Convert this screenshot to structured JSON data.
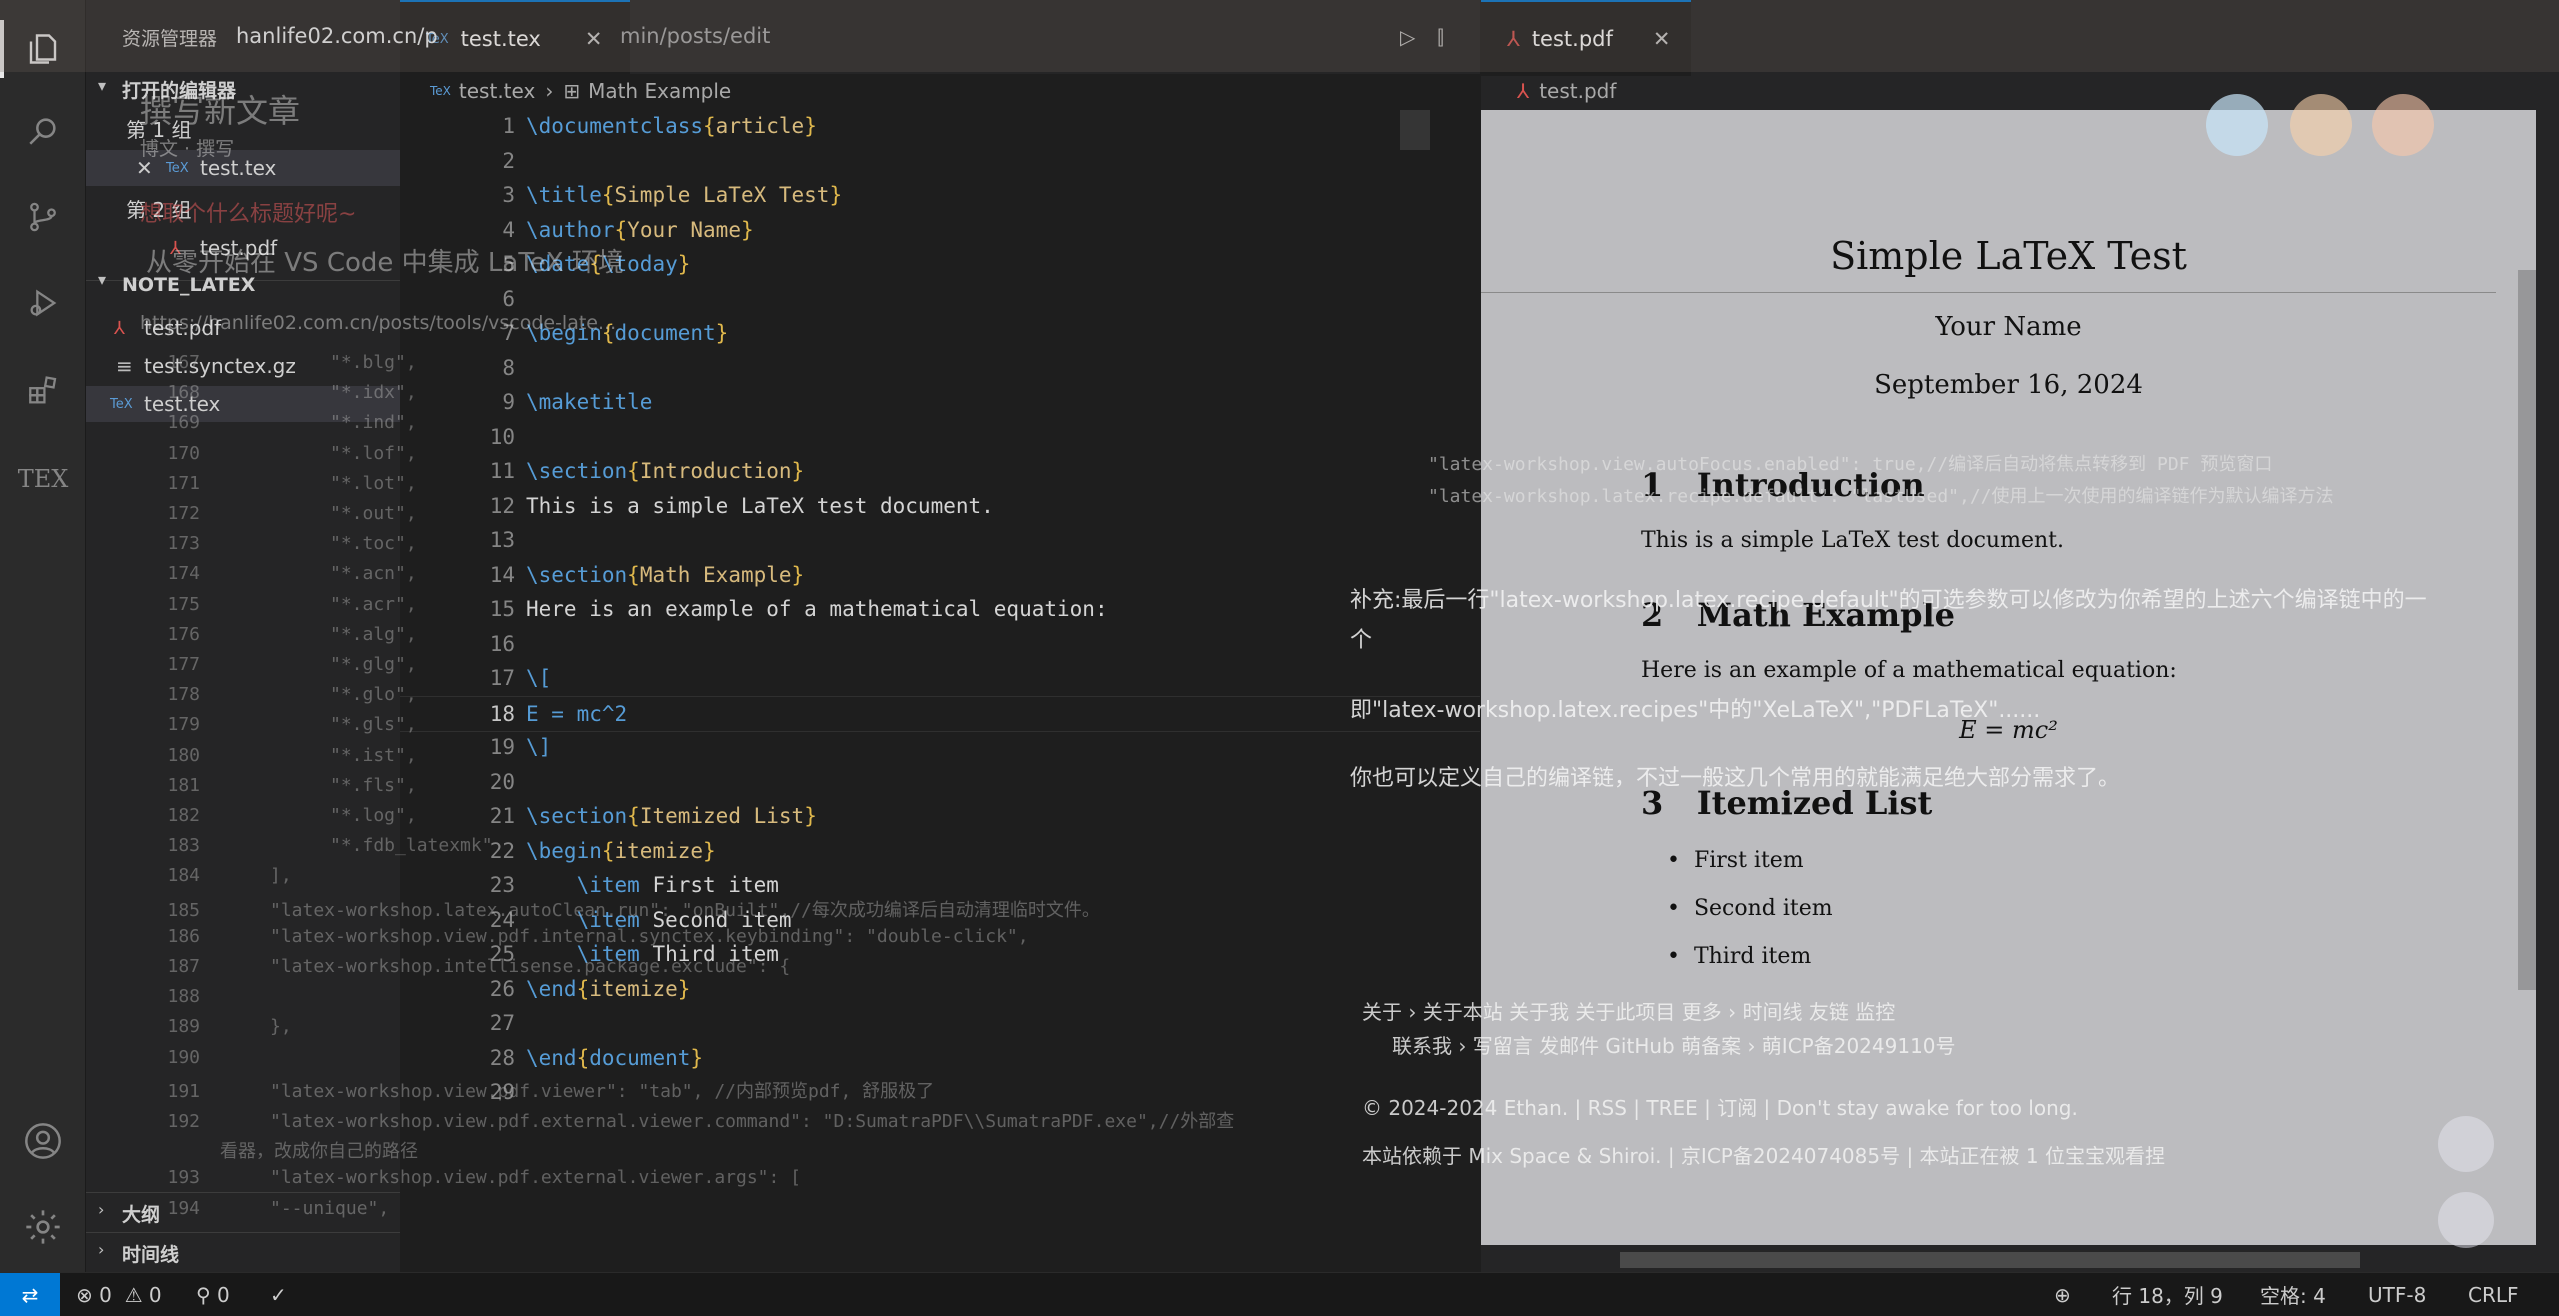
{
  "browser": {
    "url": "hanlife02.com.cn/p",
    "url_tail": "min/posts/edit"
  },
  "activity": {
    "icons": [
      "files-icon",
      "search-icon",
      "source-control-icon",
      "run-debug-icon",
      "extensions-icon",
      "tex-icon",
      "account-icon",
      "gear-icon"
    ],
    "tex_label": "TEX"
  },
  "sidebar": {
    "title": "资源管理器",
    "open_editors": {
      "title": "打开的编辑器",
      "group1": "第 1 组",
      "group1_file": "test.tex",
      "group2": "第 2 组",
      "group2_file": "test.pdf"
    },
    "folder": {
      "title": "NOTE_LATEX",
      "files": [
        "test.pdf",
        "test.synctex.gz",
        "test.tex"
      ]
    },
    "outline": "大纲",
    "timeline": "时间线"
  },
  "editor": {
    "tab_label": "test.tex",
    "breadcrumb_file": "test.tex",
    "breadcrumb_symbol": "Math Example",
    "current_line": "18",
    "lines": [
      {
        "n": "1",
        "t": [
          [
            "kw",
            "\\documentclass"
          ],
          [
            "br",
            "{"
          ],
          [
            "gr",
            "article"
          ],
          [
            "br",
            "}"
          ]
        ]
      },
      {
        "n": "2",
        "t": []
      },
      {
        "n": "3",
        "t": [
          [
            "kw",
            "\\title"
          ],
          [
            "br",
            "{"
          ],
          [
            "gr",
            "Simple LaTeX Test"
          ],
          [
            "br",
            "}"
          ]
        ]
      },
      {
        "n": "4",
        "t": [
          [
            "kw",
            "\\author"
          ],
          [
            "br",
            "{"
          ],
          [
            "gr",
            "Your Name"
          ],
          [
            "br",
            "}"
          ]
        ]
      },
      {
        "n": "5",
        "t": [
          [
            "kw",
            "\\date"
          ],
          [
            "br",
            "{"
          ],
          [
            "kw",
            "\\today"
          ],
          [
            "br",
            "}"
          ]
        ]
      },
      {
        "n": "6",
        "t": []
      },
      {
        "n": "7",
        "t": [
          [
            "kw",
            "\\begin"
          ],
          [
            "br",
            "{"
          ],
          [
            "kw",
            "document"
          ],
          [
            "br",
            "}"
          ]
        ]
      },
      {
        "n": "8",
        "t": []
      },
      {
        "n": "9",
        "t": [
          [
            "kw",
            "\\maketitle"
          ]
        ]
      },
      {
        "n": "10",
        "t": []
      },
      {
        "n": "11",
        "t": [
          [
            "kw",
            "\\section"
          ],
          [
            "br",
            "{"
          ],
          [
            "gr",
            "Introduction"
          ],
          [
            "br",
            "}"
          ]
        ]
      },
      {
        "n": "12",
        "t": [
          [
            "",
            "This is a simple LaTeX test document."
          ]
        ]
      },
      {
        "n": "13",
        "t": []
      },
      {
        "n": "14",
        "t": [
          [
            "kw",
            "\\section"
          ],
          [
            "br",
            "{"
          ],
          [
            "gr",
            "Math Example"
          ],
          [
            "br",
            "}"
          ]
        ]
      },
      {
        "n": "15",
        "t": [
          [
            "",
            "Here is an example of a mathematical equation:"
          ]
        ]
      },
      {
        "n": "16",
        "t": []
      },
      {
        "n": "17",
        "t": [
          [
            "kw",
            "\\["
          ]
        ]
      },
      {
        "n": "18",
        "t": [
          [
            "kw",
            "E = mc^2"
          ]
        ]
      },
      {
        "n": "19",
        "t": [
          [
            "kw",
            "\\]"
          ]
        ]
      },
      {
        "n": "20",
        "t": []
      },
      {
        "n": "21",
        "t": [
          [
            "kw",
            "\\section"
          ],
          [
            "br",
            "{"
          ],
          [
            "gr",
            "Itemized List"
          ],
          [
            "br",
            "}"
          ]
        ]
      },
      {
        "n": "22",
        "t": [
          [
            "kw",
            "\\begin"
          ],
          [
            "br",
            "{"
          ],
          [
            "gr",
            "itemize"
          ],
          [
            "br",
            "}"
          ]
        ]
      },
      {
        "n": "23",
        "t": [
          [
            "",
            "    "
          ],
          [
            "kw",
            "\\item"
          ],
          [
            "",
            " First item"
          ]
        ]
      },
      {
        "n": "24",
        "t": [
          [
            "",
            "    "
          ],
          [
            "kw",
            "\\item"
          ],
          [
            "",
            " Second item"
          ]
        ]
      },
      {
        "n": "25",
        "t": [
          [
            "",
            "    "
          ],
          [
            "kw",
            "\\item"
          ],
          [
            "",
            " Third item"
          ]
        ]
      },
      {
        "n": "26",
        "t": [
          [
            "kw",
            "\\end"
          ],
          [
            "br",
            "{"
          ],
          [
            "gr",
            "itemize"
          ],
          [
            "br",
            "}"
          ]
        ]
      },
      {
        "n": "27",
        "t": []
      },
      {
        "n": "28",
        "t": [
          [
            "kw",
            "\\end"
          ],
          [
            "br",
            "{"
          ],
          [
            "kw",
            "document"
          ],
          [
            "br",
            "}"
          ]
        ]
      },
      {
        "n": "29",
        "t": []
      }
    ]
  },
  "pdf": {
    "tab_label": "test.pdf",
    "breadcrumb": "test.pdf",
    "title": "Simple LaTeX Test",
    "author": "Your Name",
    "date": "September 16, 2024",
    "sec1_num": "1",
    "sec1": "Introduction",
    "sec1_body": "This is a simple LaTeX test document.",
    "sec2_num": "2",
    "sec2": "Math Example",
    "sec2_body": "Here is an example of a mathematical equation:",
    "equation": "E = mc²",
    "sec3_num": "3",
    "sec3": "Itemized List",
    "items": [
      "First item",
      "Second item",
      "Third item"
    ]
  },
  "ghost": {
    "page_title": "撰写新文章",
    "page_sub": "博文 · 撰写",
    "placeholder": "想取个什么标题好呢~",
    "post_title": "从零开始在 VS Code 中集成 LaTeX 环境",
    "post_url": "https://hanlife02.com.cn/posts/tools/vscode-late...",
    "code_lines": [
      {
        "n": "167",
        "t": "\"*.blg\","
      },
      {
        "n": "168",
        "t": "\"*.idx\","
      },
      {
        "n": "169",
        "t": "\"*.ind\","
      },
      {
        "n": "170",
        "t": "\"*.lof\","
      },
      {
        "n": "171",
        "t": "\"*.lot\","
      },
      {
        "n": "172",
        "t": "\"*.out\","
      },
      {
        "n": "173",
        "t": "\"*.toc\","
      },
      {
        "n": "174",
        "t": "\"*.acn\","
      },
      {
        "n": "175",
        "t": "\"*.acr\","
      },
      {
        "n": "176",
        "t": "\"*.alg\","
      },
      {
        "n": "177",
        "t": "\"*.glg\","
      },
      {
        "n": "178",
        "t": "\"*.glo\","
      },
      {
        "n": "179",
        "t": "\"*.gls\","
      },
      {
        "n": "180",
        "t": "\"*.ist\","
      },
      {
        "n": "181",
        "t": "\"*.fls\","
      },
      {
        "n": "182",
        "t": "\"*.log\","
      },
      {
        "n": "183",
        "t": "\"*.fdb_latexmk\""
      },
      {
        "n": "184",
        "t": "],"
      },
      {
        "n": "185",
        "t": "\"latex-workshop.latex.autoClean.run\": \"onBuilt\",//每次成功编译后自动清理临时文件。"
      },
      {
        "n": "186",
        "t": "\"latex-workshop.view.pdf.internal.synctex.keybinding\": \"double-click\","
      },
      {
        "n": "187",
        "t": "\"latex-workshop.intellisense.package.exclude\": {"
      },
      {
        "n": "188",
        "t": ""
      },
      {
        "n": "189",
        "t": "},"
      },
      {
        "n": "190",
        "t": ""
      },
      {
        "n": "191",
        "t": "\"latex-workshop.view.pdf.viewer\": \"tab\",  //内部预览pdf, 舒服极了"
      },
      {
        "n": "192",
        "t": "\"latex-workshop.view.pdf.external.viewer.command\": \"D:SumatraPDF\\\\SumatraPDF.exe\",//外部查"
      },
      {
        "n": "",
        "t": "看器，改成你自己的路径"
      },
      {
        "n": "193",
        "t": "\"latex-workshop.view.pdf.external.viewer.args\": ["
      },
      {
        "n": "194",
        "t": "\"--unique\","
      }
    ],
    "pdf_code1": "\"latex-workshop.view.autoFocus.enabled\": true,//编译后自动将焦点转移到 PDF 预览窗口",
    "pdf_code2": "\"latex-workshop.latex.recipe.default\": \"lastUsed\",//使用上一次使用的编译链作为默认编译方法",
    "para1": "补充:最后一行\"latex-workshop.latex.recipe.default\"的可选参数可以修改为你希望的上述六个编译链中的一",
    "para1b": "个",
    "para2": "即\"latex-workshop.latex.recipes\"中的\"XeLaTeX\",\"PDFLaTeX\"......",
    "para3": "你也可以定义自己的编译链，不过一般这几个常用的就能满足绝大部分需求了。",
    "footer1": "关于   ›    关于本站   关于我   关于此项目     更多   ›    时间线   友链   监控",
    "footer2": "联系我   ›    写留言   发邮件   GitHub     萌备案   ›    萌ICP备20249110号",
    "footer3": "© 2024-2024 Ethan. | RSS | TREE | 订阅 | Don't stay awake for too long.",
    "footer4": "本站依赖于 Mix Space & Shiroi. | 京ICP备2024074085号 | 本站正在被 1 位宝宝观看捏"
  },
  "status": {
    "errors": "0",
    "warnings": "0",
    "ports": "0",
    "cursor": "行 18，列 9",
    "indent": "空格: 4",
    "encoding": "UTF-8",
    "eol": "CRLF"
  },
  "colors": {
    "bg": "#1e1e1e",
    "sidebar": "#252526",
    "activity": "#2b2b2b",
    "pdf_page": "#bcbcbf",
    "keyword": "#569cd6",
    "bracket": "#e0b84c",
    "string": "#d7ba7d"
  }
}
